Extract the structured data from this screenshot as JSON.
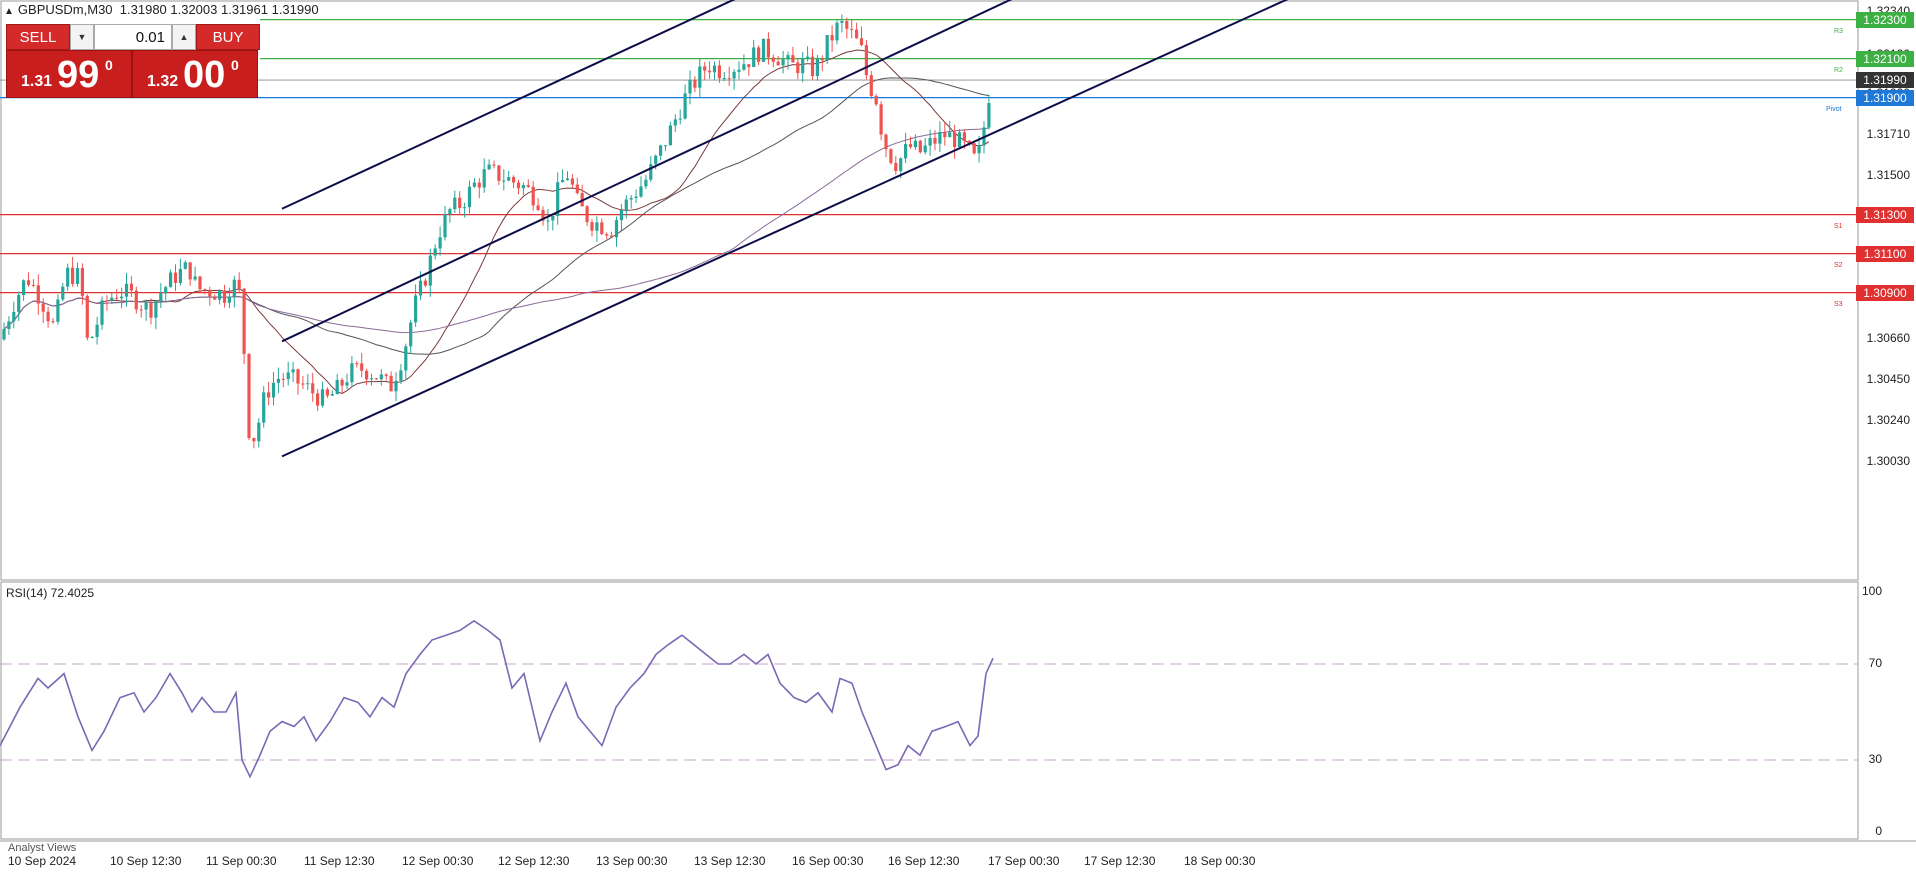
{
  "header": {
    "symbol_line": "GBPUSDm,M30",
    "ohlc": "1.31980  1.32003  1.31961  1.31990"
  },
  "trade_panel": {
    "sell_label": "SELL",
    "buy_label": "BUY",
    "lot_value": "0.01",
    "bid_prefix": "1.31",
    "bid_big": "99",
    "bid_sup": "0",
    "ask_prefix": "1.32",
    "ask_big": "00",
    "ask_sup": "0"
  },
  "price_scale": [
    "1.32340",
    "1.32120",
    "1.31920",
    "1.31710",
    "1.31500",
    "1.31290",
    "1.31080",
    "1.30870",
    "1.30660",
    "1.30450",
    "1.30240",
    "1.30030"
  ],
  "level_labels": [
    {
      "text": "1.32300",
      "color": "#3cb043"
    },
    {
      "text": "1.32100",
      "color": "#3cb043"
    },
    {
      "text": "1.31990",
      "color": "#333333"
    },
    {
      "text": "1.31900",
      "color": "#1e78d8"
    },
    {
      "text": "1.31300",
      "color": "#e03030"
    },
    {
      "text": "1.31100",
      "color": "#e03030"
    },
    {
      "text": "1.30900",
      "color": "#e03030"
    }
  ],
  "pivot_tags": [
    "R3",
    "R2",
    "Pivot",
    "S1",
    "S2",
    "S3"
  ],
  "rsi": {
    "title": "RSI(14) 72.4025",
    "levels": [
      "100",
      "70",
      "30",
      "0"
    ]
  },
  "x_axis": [
    "10 Sep 2024",
    "10 Sep 12:30",
    "11 Sep 00:30",
    "11 Sep 12:30",
    "12 Sep 00:30",
    "12 Sep 12:30",
    "13 Sep 00:30",
    "13 Sep 12:30",
    "16 Sep 00:30",
    "16 Sep 12:30",
    "17 Sep 00:30",
    "17 Sep 12:30",
    "18 Sep 00:30"
  ],
  "footer": {
    "analyst_label": "Analyst Views"
  },
  "colors": {
    "bull": "#26a69a",
    "bear": "#ef5350",
    "channel": "#0d0d4a",
    "resistance": "#3cb043",
    "support": "#e03030",
    "pivot": "#1e78d8",
    "rsi": "#7b68b5"
  },
  "chart_data": {
    "type": "candlestick",
    "symbol": "GBPUSDm",
    "timeframe": "M30",
    "levels": {
      "R3": 1.323,
      "R2": 1.321,
      "pivot": 1.319,
      "S1": 1.313,
      "S2": 1.311,
      "S3": 1.309,
      "last": 1.3199
    },
    "price_range": [
      1.2999,
      1.3237
    ],
    "price_path": [
      [
        0,
        1.3066
      ],
      [
        14,
        1.3085
      ],
      [
        27,
        1.3098
      ],
      [
        40,
        1.3088
      ],
      [
        54,
        1.3072
      ],
      [
        66,
        1.31
      ],
      [
        80,
        1.3098
      ],
      [
        88,
        1.3062
      ],
      [
        96,
        1.3073
      ],
      [
        105,
        1.3085
      ],
      [
        119,
        1.3091
      ],
      [
        133,
        1.3088
      ],
      [
        149,
        1.3081
      ],
      [
        162,
        1.3091
      ],
      [
        176,
        1.3099
      ],
      [
        189,
        1.3103
      ],
      [
        197,
        1.3092
      ],
      [
        210,
        1.3091
      ],
      [
        225,
        1.3089
      ],
      [
        232,
        1.3096
      ],
      [
        241,
        1.3088
      ],
      [
        245,
        1.3052
      ],
      [
        250,
        1.3012
      ],
      [
        256,
        1.3018
      ],
      [
        264,
        1.3035
      ],
      [
        270,
        1.3042
      ],
      [
        280,
        1.3047
      ],
      [
        295,
        1.3045
      ],
      [
        310,
        1.304
      ],
      [
        325,
        1.3034
      ],
      [
        337,
        1.304
      ],
      [
        350,
        1.3049
      ],
      [
        363,
        1.3051
      ],
      [
        378,
        1.3047
      ],
      [
        390,
        1.3041
      ],
      [
        403,
        1.3058
      ],
      [
        414,
        1.3082
      ],
      [
        426,
        1.3099
      ],
      [
        438,
        1.312
      ],
      [
        450,
        1.3132
      ],
      [
        462,
        1.3136
      ],
      [
        474,
        1.3145
      ],
      [
        487,
        1.3152
      ],
      [
        500,
        1.315
      ],
      [
        513,
        1.3147
      ],
      [
        525,
        1.3144
      ],
      [
        538,
        1.3138
      ],
      [
        548,
        1.3125
      ],
      [
        560,
        1.3145
      ],
      [
        568,
        1.3151
      ],
      [
        578,
        1.3135
      ],
      [
        590,
        1.3127
      ],
      [
        600,
        1.3125
      ],
      [
        611,
        1.3122
      ],
      [
        620,
        1.3132
      ],
      [
        633,
        1.314
      ],
      [
        646,
        1.3148
      ],
      [
        660,
        1.3162
      ],
      [
        672,
        1.3175
      ],
      [
        684,
        1.3189
      ],
      [
        696,
        1.3199
      ],
      [
        708,
        1.3207
      ],
      [
        721,
        1.3204
      ],
      [
        734,
        1.3206
      ],
      [
        747,
        1.3209
      ],
      [
        762,
        1.3215
      ],
      [
        776,
        1.3212
      ],
      [
        790,
        1.3206
      ],
      [
        803,
        1.3207
      ],
      [
        815,
        1.3204
      ],
      [
        828,
        1.3218
      ],
      [
        840,
        1.3228
      ],
      [
        852,
        1.3222
      ],
      [
        861,
        1.3215
      ],
      [
        868,
        1.3198
      ],
      [
        876,
        1.319
      ],
      [
        882,
        1.3172
      ],
      [
        888,
        1.3162
      ],
      [
        897,
        1.3156
      ],
      [
        909,
        1.3165
      ],
      [
        921,
        1.3162
      ],
      [
        932,
        1.3167
      ],
      [
        944,
        1.3171
      ],
      [
        955,
        1.3169
      ],
      [
        968,
        1.3163
      ],
      [
        977,
        1.3156
      ],
      [
        984,
        1.3175
      ],
      [
        989,
        1.3192
      ],
      [
        993,
        1.3199
      ]
    ],
    "channel_lines": [
      {
        "name": "upper",
        "from": [
          282,
          1.3133
        ],
        "to": [
          800,
          1.3256
        ]
      },
      {
        "name": "middle",
        "from": [
          282,
          1.3065
        ],
        "to": [
          1076,
          1.3256
        ]
      },
      {
        "name": "lower",
        "from": [
          282,
          1.3006
        ],
        "to": [
          1354,
          1.3256
        ]
      }
    ],
    "rsi_series": {
      "name": "RSI(14)",
      "last": 72.4025,
      "range": [
        0,
        100
      ],
      "levels": [
        70,
        30
      ],
      "values": [
        [
          0,
          36
        ],
        [
          20,
          52
        ],
        [
          38,
          64
        ],
        [
          48,
          60
        ],
        [
          64,
          66
        ],
        [
          78,
          48
        ],
        [
          92,
          34
        ],
        [
          104,
          42
        ],
        [
          120,
          56
        ],
        [
          134,
          58
        ],
        [
          144,
          50
        ],
        [
          156,
          56
        ],
        [
          170,
          66
        ],
        [
          182,
          58
        ],
        [
          192,
          50
        ],
        [
          202,
          56
        ],
        [
          214,
          50
        ],
        [
          226,
          50
        ],
        [
          236,
          58
        ],
        [
          242,
          30
        ],
        [
          250,
          23
        ],
        [
          260,
          32
        ],
        [
          270,
          42
        ],
        [
          282,
          46
        ],
        [
          294,
          44
        ],
        [
          304,
          48
        ],
        [
          316,
          38
        ],
        [
          330,
          46
        ],
        [
          344,
          56
        ],
        [
          358,
          54
        ],
        [
          370,
          48
        ],
        [
          382,
          56
        ],
        [
          394,
          52
        ],
        [
          406,
          66
        ],
        [
          420,
          74
        ],
        [
          432,
          80
        ],
        [
          446,
          82
        ],
        [
          460,
          84
        ],
        [
          474,
          88
        ],
        [
          488,
          84
        ],
        [
          500,
          80
        ],
        [
          512,
          60
        ],
        [
          524,
          66
        ],
        [
          540,
          38
        ],
        [
          552,
          50
        ],
        [
          566,
          62
        ],
        [
          578,
          48
        ],
        [
          590,
          42
        ],
        [
          602,
          36
        ],
        [
          616,
          52
        ],
        [
          630,
          60
        ],
        [
          644,
          66
        ],
        [
          656,
          74
        ],
        [
          668,
          78
        ],
        [
          682,
          82
        ],
        [
          694,
          78
        ],
        [
          706,
          74
        ],
        [
          718,
          70
        ],
        [
          730,
          70
        ],
        [
          744,
          74
        ],
        [
          756,
          70
        ],
        [
          768,
          74
        ],
        [
          780,
          62
        ],
        [
          794,
          56
        ],
        [
          806,
          54
        ],
        [
          818,
          58
        ],
        [
          832,
          50
        ],
        [
          840,
          64
        ],
        [
          852,
          62
        ],
        [
          862,
          50
        ],
        [
          874,
          38
        ],
        [
          886,
          26
        ],
        [
          898,
          28
        ],
        [
          908,
          36
        ],
        [
          920,
          32
        ],
        [
          932,
          42
        ],
        [
          946,
          44
        ],
        [
          958,
          46
        ],
        [
          970,
          36
        ],
        [
          978,
          40
        ],
        [
          986,
          66
        ],
        [
          993,
          72.4
        ]
      ]
    }
  }
}
